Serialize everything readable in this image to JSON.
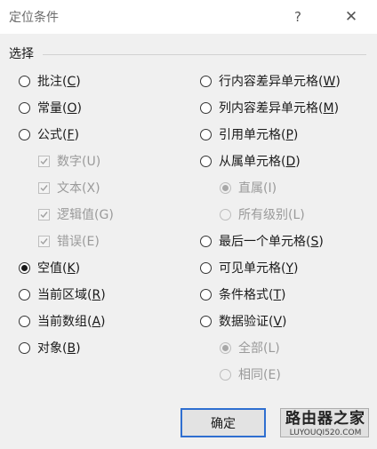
{
  "dialog": {
    "title": "定位条件",
    "help_label": "?",
    "close_label": "✕"
  },
  "group": {
    "label": "选择"
  },
  "left_options": [
    {
      "text": "批注",
      "key": "C",
      "checked": false,
      "disabled": false
    },
    {
      "text": "常量",
      "key": "O",
      "checked": false,
      "disabled": false
    },
    {
      "text": "公式",
      "key": "F",
      "checked": false,
      "disabled": false
    },
    {
      "text": "数字",
      "key": "U",
      "checked": true,
      "disabled": true
    },
    {
      "text": "文本",
      "key": "X",
      "checked": true,
      "disabled": true
    },
    {
      "text": "逻辑值",
      "key": "G",
      "checked": true,
      "disabled": true
    },
    {
      "text": "错误",
      "key": "E",
      "checked": true,
      "disabled": true
    },
    {
      "text": "空值",
      "key": "K",
      "checked": true,
      "disabled": false
    },
    {
      "text": "当前区域",
      "key": "R",
      "checked": false,
      "disabled": false
    },
    {
      "text": "当前数组",
      "key": "A",
      "checked": false,
      "disabled": false
    },
    {
      "text": "对象",
      "key": "B",
      "checked": false,
      "disabled": false
    }
  ],
  "right_options": [
    {
      "text": "行内容差异单元格",
      "key": "W",
      "checked": false,
      "disabled": false
    },
    {
      "text": "列内容差异单元格",
      "key": "M",
      "checked": false,
      "disabled": false
    },
    {
      "text": "引用单元格",
      "key": "P",
      "checked": false,
      "disabled": false
    },
    {
      "text": "从属单元格",
      "key": "D",
      "checked": false,
      "disabled": false
    },
    {
      "text": "直属",
      "key": "I",
      "checked": true,
      "disabled": true
    },
    {
      "text": "所有级别",
      "key": "L",
      "checked": false,
      "disabled": true
    },
    {
      "text": "最后一个单元格",
      "key": "S",
      "checked": false,
      "disabled": false
    },
    {
      "text": "可见单元格",
      "key": "Y",
      "checked": false,
      "disabled": false
    },
    {
      "text": "条件格式",
      "key": "T",
      "checked": false,
      "disabled": false
    },
    {
      "text": "数据验证",
      "key": "V",
      "checked": false,
      "disabled": false
    },
    {
      "text": "全部",
      "key": "L",
      "checked": true,
      "disabled": true
    },
    {
      "text": "相同",
      "key": "E",
      "checked": false,
      "disabled": true
    }
  ],
  "buttons": {
    "ok_label": "确定"
  },
  "watermark": {
    "top": "路由器之家",
    "bottom": "LUYOUQI520.COM"
  },
  "colors": {
    "focus_border": "#2f6fd0",
    "background": "#f0f0f0"
  }
}
